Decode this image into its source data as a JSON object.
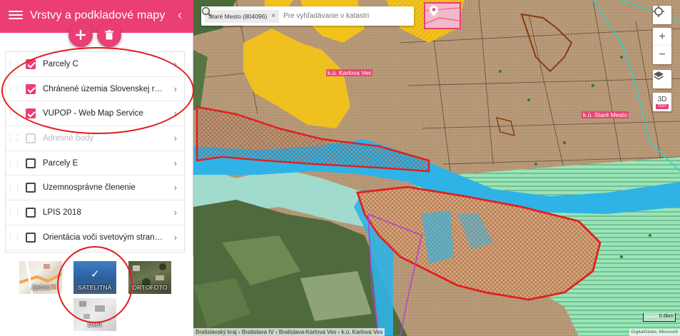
{
  "sidebar": {
    "title": "Vrstvy a podkladové mapy",
    "add_icon": "plus-icon",
    "delete_icon": "trash-icon",
    "layers": [
      {
        "label": "Parcely C",
        "checked": true,
        "enabled": true
      },
      {
        "label": "Chránené územia Slovenskej republ...",
        "checked": true,
        "enabled": true
      },
      {
        "label": "VUPOP - Web Map Service",
        "checked": true,
        "enabled": true
      },
      {
        "label": "Adresné body",
        "checked": false,
        "enabled": false
      },
      {
        "label": "Parcely E",
        "checked": false,
        "enabled": true
      },
      {
        "label": "Územnosprávne členenie",
        "checked": false,
        "enabled": true
      },
      {
        "label": "LPIS 2018",
        "checked": false,
        "enabled": true
      },
      {
        "label": "Orientácia voči svetovým stranám",
        "checked": false,
        "enabled": true
      }
    ],
    "basemaps": [
      {
        "label": "ZBGIS",
        "selected": false
      },
      {
        "label": "SATELITNÁ",
        "selected": true
      },
      {
        "label": "ORTOFOTO",
        "selected": false
      },
      {
        "label": "DMR",
        "selected": false
      }
    ]
  },
  "search": {
    "chip": "Staré Mesto (804096)",
    "chip_close": "×",
    "placeholder": "Pre vyhľadávanie v katastri"
  },
  "map": {
    "labels": {
      "karlova_ves": "k.ú. Karlova Ves",
      "stare_mesto": "k.ú. Staré Mesto"
    },
    "controls": {
      "zoom_in": "+",
      "zoom_out": "−",
      "three_d": "3D",
      "test": "TEST"
    },
    "scale": "0.6km",
    "breadcrumb": "Bratislavský kraj › Bratislava IV › Bratislava-Karlova Ves › k.ú. Karlova Ves",
    "attribution": "DigitalGlobe, Microsoft"
  },
  "colors": {
    "accent": "#ea3e74",
    "annotation": "#e41b1b",
    "river": "#2fb3e6",
    "protected_area": "#e02020",
    "vupop_yellow": "#f2c21b"
  }
}
